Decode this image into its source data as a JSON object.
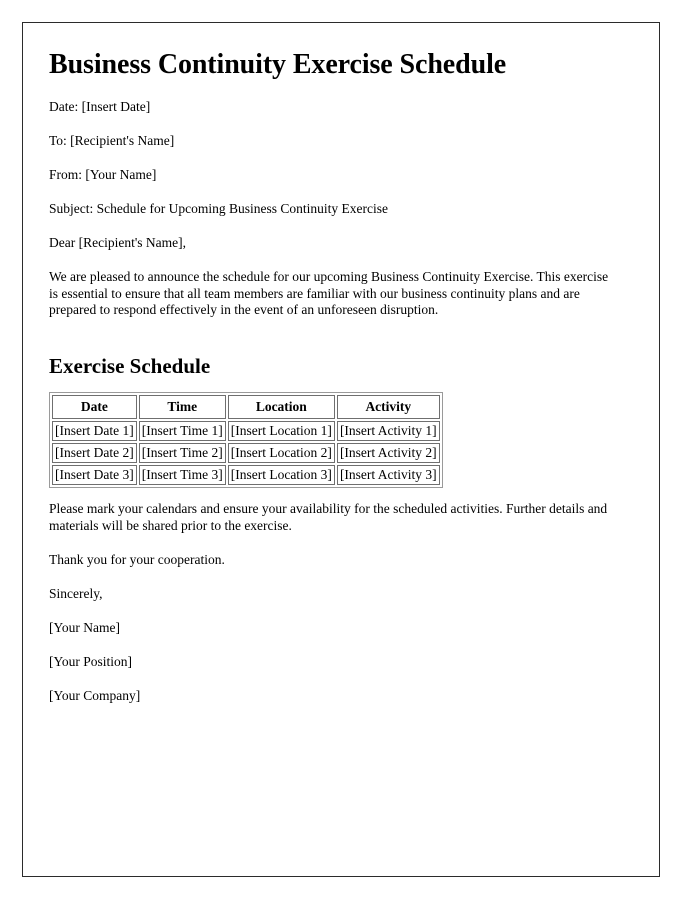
{
  "document": {
    "title": "Business Continuity Exercise Schedule",
    "header_fields": [
      "Date: [Insert Date]",
      "To: [Recipient's Name]",
      "From: [Your Name]",
      "Subject: Schedule for Upcoming Business Continuity Exercise"
    ],
    "salutation": "Dear [Recipient's Name],",
    "intro_paragraph": "We are pleased to announce the schedule for our upcoming Business Continuity Exercise. This exercise is essential to ensure that all team members are familiar with our business continuity plans and are prepared to respond effectively in the event of an unforeseen disruption.",
    "section_heading": "Exercise Schedule",
    "table": {
      "columns": [
        "Date",
        "Time",
        "Location",
        "Activity"
      ],
      "rows": [
        [
          "[Insert Date 1]",
          "[Insert Time 1]",
          "[Insert Location 1]",
          "[Insert Activity 1]"
        ],
        [
          "[Insert Date 2]",
          "[Insert Time 2]",
          "[Insert Location 2]",
          "[Insert Activity 2]"
        ],
        [
          "[Insert Date 3]",
          "[Insert Time 3]",
          "[Insert Location 3]",
          "[Insert Activity 3]"
        ]
      ]
    },
    "closing_paragraph": "Please mark your calendars and ensure your availability for the scheduled activities. Further details and materials will be shared prior to the exercise.",
    "thanks_line": "Thank you for your cooperation.",
    "sign_off": "Sincerely,",
    "signature_block": [
      "[Your Name]",
      "[Your Position]",
      "[Your Company]"
    ]
  },
  "colors": {
    "page_background": "#ffffff",
    "page_border": "#2b2b2b",
    "text": "#000000",
    "table_border": "#6f6f6f"
  }
}
